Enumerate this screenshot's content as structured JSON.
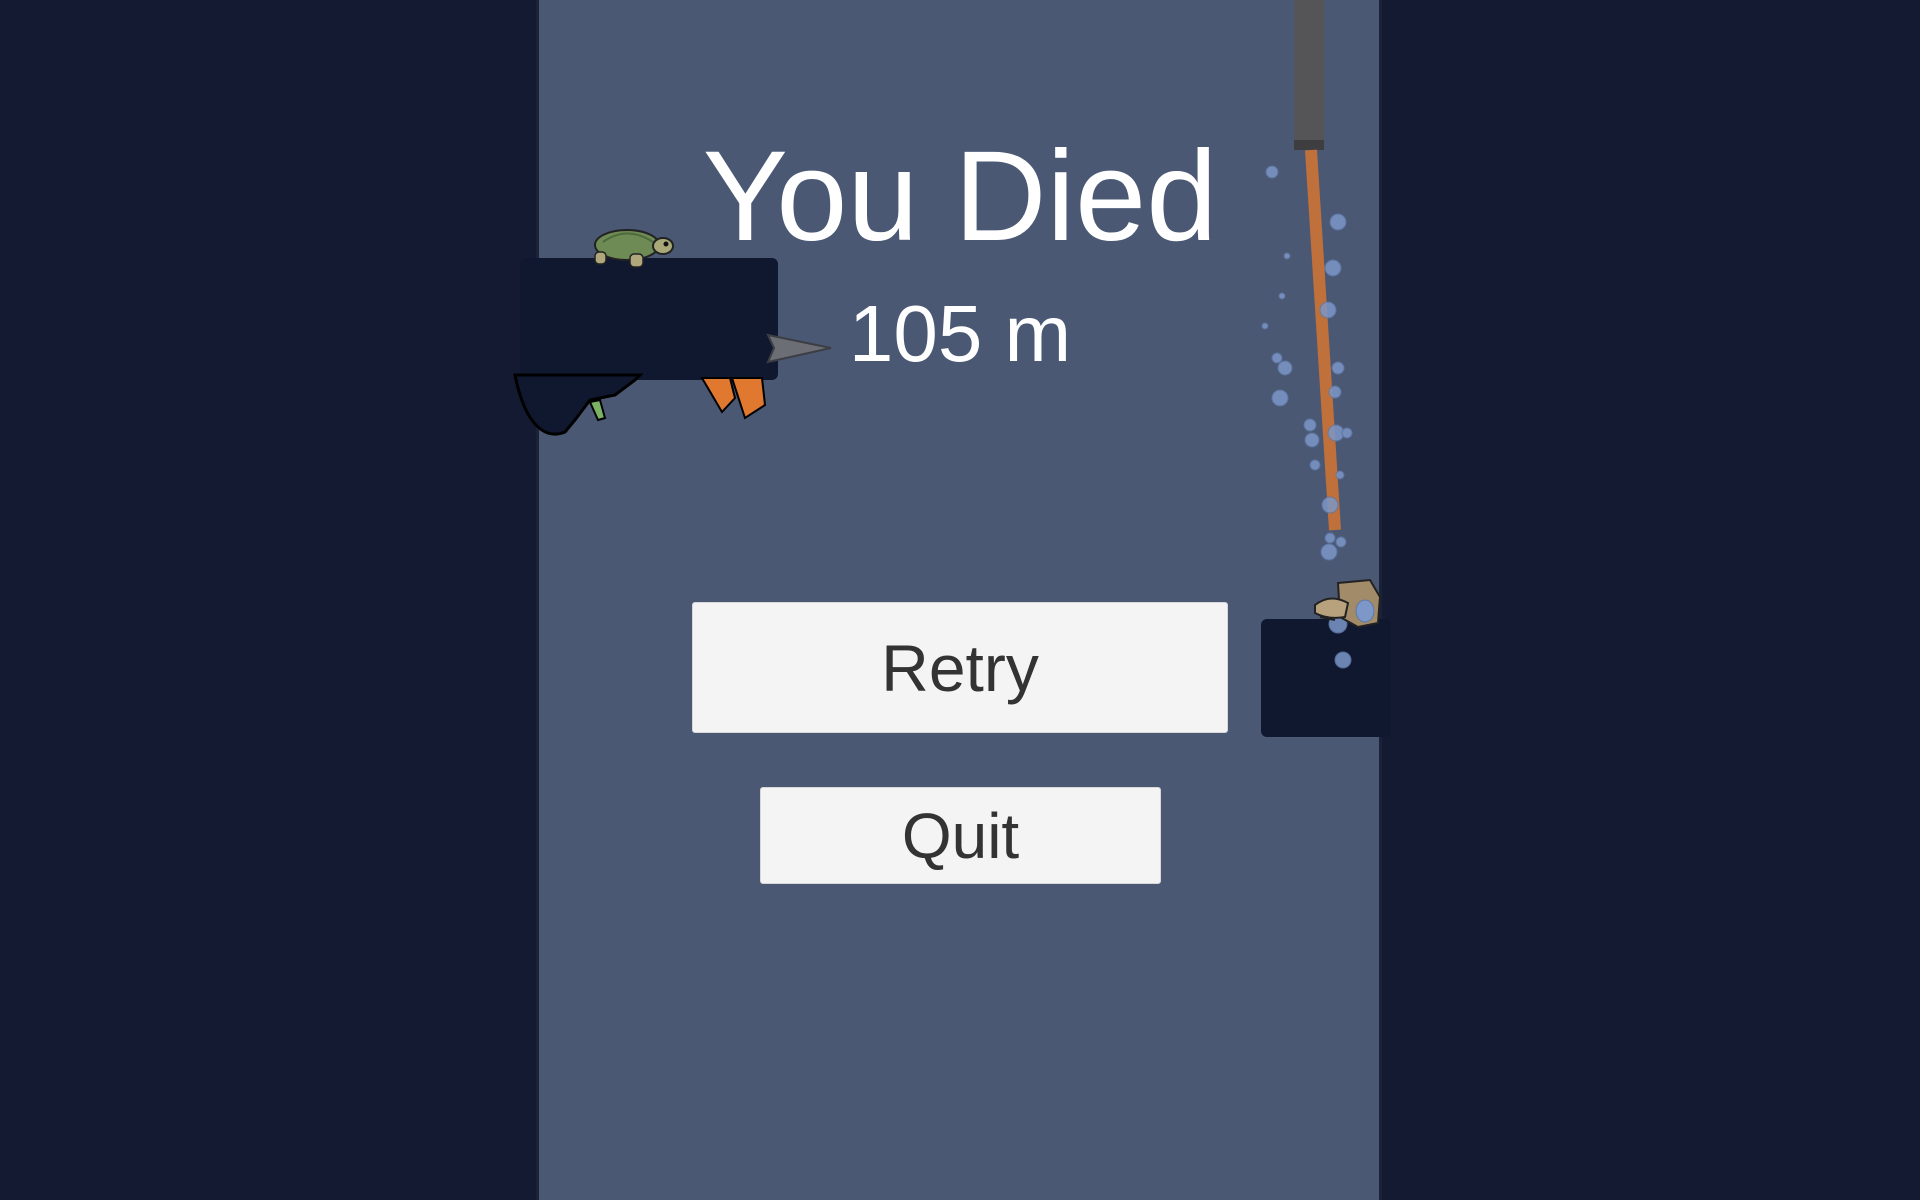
{
  "screen": {
    "title": "You Died",
    "distance": "105 m"
  },
  "buttons": {
    "retry_label": "Retry",
    "quit_label": "Quit"
  },
  "scene": {
    "icons": [
      "turtle-icon",
      "crab-icon",
      "spike-icon",
      "hook-icon"
    ],
    "colors": {
      "background": "#131a31",
      "shaft": "#4a5874",
      "rock": "#101830",
      "rope": "#c0703a",
      "bubbles": "#7d97c8"
    }
  }
}
